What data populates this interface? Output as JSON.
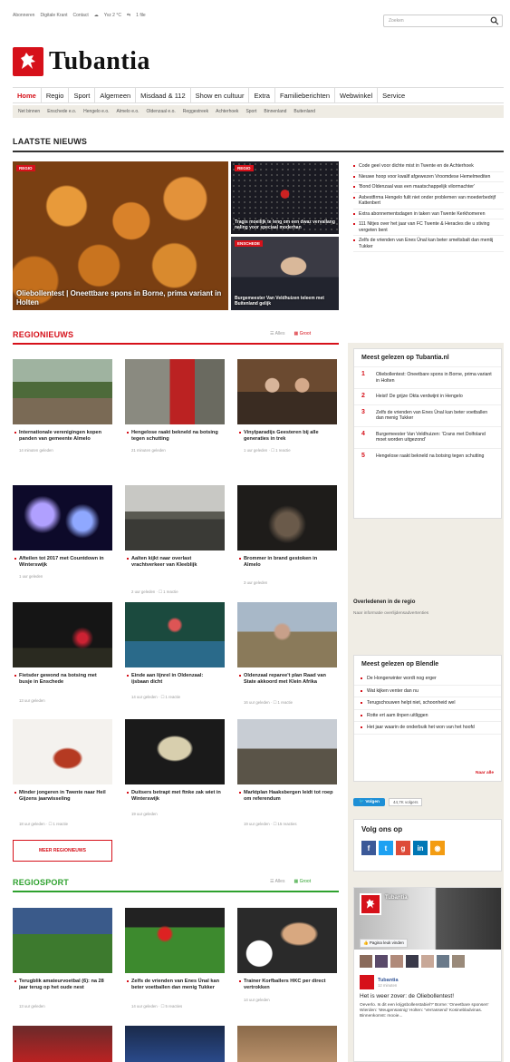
{
  "topbar": {
    "links": [
      "Abonneren",
      "Digitale Krant",
      "Contact"
    ],
    "weather": "Yvz 2 °C",
    "weather2": "1 file",
    "search_placeholder": "Zoeken"
  },
  "logo": {
    "name": "Tubantia"
  },
  "nav": [
    "Home",
    "Regio",
    "Sport",
    "Algemeen",
    "Misdaad & 112",
    "Show en cultuur",
    "Extra",
    "Familieberichten",
    "Webwinkel",
    "Service"
  ],
  "subnav": [
    "Net binnen",
    "Enschede e.o.",
    "Hengelo e.o.",
    "Almelo e.o.",
    "Oldenzaal e.o.",
    "Reggestreek",
    "Achterhoek",
    "Sport",
    "Binnenland",
    "Buitenland"
  ],
  "latest": {
    "title": "LAATSTE NIEUWS",
    "hero_tag": "REGIO",
    "hero_caption": "Oliebollentest | Oneettbare spons in Borne, prima variant in Holten",
    "mid1_tag": "REGIO",
    "mid1_caption": "Tragis moeilijk te leng om een dwaz vervallang naling voor speciaal moderhan",
    "mid2_tag": "ENSCHEDE",
    "mid2_caption": "Burgemeester Van Veldhuizen teleem met Buitenland gelijk",
    "list": [
      "Code geel voor dichte mist in Twente en de Achterhoek",
      "Nieuwe hoop voor kwalif afgewezen Vroomdese Hemelmediten",
      "'Bond Oldenzaal was een maatschappelijk vilormachter'",
      "Asbestfirma Hengelo fulit niet onder problemen van moederbedrijf Kattenbert",
      "Extra abonnementsdagen in taken van Twente Kerkhomeren",
      "111 Nitjes over het jaar van FC Twente & Heracles die u stiving vergeten bent",
      "Zelfs de vrienden van Enes Ünal kan beter smeltsbalt dan mentij Tukker"
    ]
  },
  "regio": {
    "title": "REGIONIEUWS",
    "toggle_list": "Alles",
    "toggle_grid": "Groot",
    "items": [
      {
        "cap": "Internationale verenigingen kopen panden van gemeente Almelo",
        "meta": "14 minuten geleden"
      },
      {
        "cap": "Hengelose raakt bekneld na botsing tegen schutting",
        "meta": "21 minuten geleden"
      },
      {
        "cap": "Vinylparadijs Geesteren bij alle generaties in trek",
        "meta": "1 uur geleden",
        "count": "1 reactie"
      },
      {
        "cap": "Afteilen tot 2017 met Countdown in Winterswijk",
        "meta": "1 uur geleden"
      },
      {
        "cap": "Aalten kijkt naar overlast vrachtverkeer van Kleeblijk",
        "meta": "2 uur geleden",
        "count": "1 reactie"
      },
      {
        "cap": "Brommer in brand gestoken in Almelo",
        "meta": "3 uur geleden"
      },
      {
        "cap": "Fietsder gewond na botsing met busje in Enschede",
        "meta": "13 uur geleden"
      },
      {
        "cap": "Einde aan lijnrel in Oldenzaal: ijsbaan dicht",
        "meta": "14 uur geleden",
        "count": "1 reactie"
      },
      {
        "cap": "Oldenzaal reparee't plan Raad van State akkoord met Klein Afrika",
        "meta": "16 uur geleden",
        "count": "1 reactie"
      },
      {
        "cap": "Minder jongeren in Twente naar Heil Gijzens jaarwisseling",
        "meta": "18 uur geleden",
        "count": "1 reactie"
      },
      {
        "cap": "Duitsers betrapt met ftnke zak wiet in Winterswijk",
        "meta": "19 uur geleden"
      },
      {
        "cap": "Marktplan Haaksbergen leidt tot roep om referendum",
        "meta": "19 uur geleden",
        "count": "15 reacties"
      }
    ],
    "more_button": "MEER REGIONIEUWS"
  },
  "sport": {
    "title": "REGIOSPORT",
    "toggle_list": "Alles",
    "toggle_grid": "Groot",
    "items": [
      {
        "cap": "Terugblik amateurvoetbal (6): na 28 jaar terug op het oude nest",
        "meta": "13 uur geleden"
      },
      {
        "cap": "Zelfs de vrienden van Enes Ünal kan beter voetballen dan menig Tukker",
        "meta": "14 uur geleden",
        "count": "5 reacties"
      },
      {
        "cap": "Trainer Korfballers HKC per direct vertrokken",
        "meta": "14 uur geleden"
      }
    ]
  },
  "side": {
    "most_read_title": "Meest gelezen op Tubantia.nl",
    "most_read": [
      "Oliebollentest: Oneetbare spons in Borne, prima variant in Holten",
      "Heist! De grijze Okta verdwijnt in Hengelo",
      "Zelfs de vrienden van Enes Ünal kan beter voetballen dan menig Tukker",
      "Burgemeester Van Veldhuizen: 'Crans met Dolfoland moet worden uitgezond'",
      "Hengelose raakt bekneld na botsing tegen schutting"
    ],
    "obit_title": "Overledenen in de regio",
    "obit_sub": "Naar informatie overlijdensadvertenties",
    "blendle_title": "Meest gelezen op Blendle",
    "blendle": [
      "De Hongerwinter wordt nog erger",
      "Wat kijken venter dan nu",
      "Terugschouwen helpt niet, schoonheid wel",
      "Rotte ert aam ilnpen uitliggen",
      "Het jaar waarin de onderbuik het won van het hoofd"
    ],
    "blendle_more": "Naar alle",
    "twitter_follow": "Volgen",
    "twitter_count": "44,7K volgers",
    "follow_title": "Volg ons op",
    "fb_name": "Tubantia",
    "fb_sub": "12 minuten",
    "fb_like": "Pagina leuk vinden",
    "fb_text": "Het is weer zover: de Oliebollentest!",
    "fb_text2": "Oeverlo. Is dit een krijgsbollenstabiel?' Borne: 'Oneetbare sponsen' Wierden: 'Meugensasnig' Holten: 'Verrassend' Kosinebladvinas. Binnenkomst: mooie..."
  },
  "colors": {
    "brand": "#d6111a",
    "sport": "#2ea12e",
    "sidebar": "#f0ede5"
  }
}
